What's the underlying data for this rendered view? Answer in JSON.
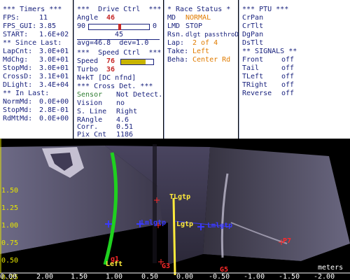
{
  "timers": {
    "header": "*** Timers ***",
    "fps_label": "FPS:",
    "fps_value": "11",
    "fpsgui_label": "FPS_GUI:",
    "fpsgui_value": "3.85",
    "start_label": "START:",
    "start_value": "1.6E+02",
    "since_header": "** Since Last:",
    "lapcnt_label": "LapCnt:",
    "lapcnt_value": "3.0E+01",
    "mdchg_label": "MdChg:",
    "mdchg_value": "3.0E+01",
    "stopmd_label": "StopMd:",
    "stopmd_value": "3.0E+01",
    "crossd_label": "CrossD:",
    "crossd_value": "3.1E+01",
    "dlight_label": "DLight:",
    "dlight_value": "3.4E+04",
    "inlast_header": "** In Last:",
    "normmd_label": "NormMd:",
    "normmd_value": "0.0E+00",
    "stopmd2_label": "StopMd:",
    "stopmd2_value": "2.8E-01",
    "rdmtmd_label": "RdMtMd:",
    "rdmtmd_value": "0.0E+00"
  },
  "drive": {
    "header": "***  Drive Ctrl  ***",
    "angle_label": "Angle",
    "angle_value": "46",
    "range_min": "90",
    "range_max": "0",
    "angle_slider_fraction": 0.51,
    "center_value": "45",
    "avg_text": "avg=46.8  dev=1.0",
    "speed_header": "***  Speed Ctrl  ***",
    "speed_label": "Speed",
    "speed_value": "76",
    "speed_fraction": 0.76,
    "turbo_label": "Turbo",
    "turbo_value": "36",
    "nokt_text": "N+kT [DC nfnd]"
  },
  "cross": {
    "header": "*** Cross Det. ***",
    "sensor_label": "Sensor",
    "sensor_value": "Not Detect.",
    "vision_label": "Vision",
    "vision_value": "no",
    "sline_label": "S. Line",
    "sline_value": "Right",
    "rangle_label": "RAngle",
    "rangle_value": "4.6",
    "corr_label": "Corr.",
    "corr_value": "0.51",
    "pix_label": "Pix Cnt",
    "pix_value": "1186"
  },
  "race": {
    "header": "* Race Status *",
    "md_label": "MD",
    "md_value": "NORMAL",
    "lmd_label": "LMD",
    "lmd_value": "STOP",
    "rsn_label": "Rsn.",
    "rsn_value": "dlgt passthroDgRan",
    "lap_label": "Lap:",
    "lap_value": "2 of 4",
    "take_label": "Take:",
    "take_value": "Left",
    "beha_label": "Beha:",
    "beha_value": "Center Rd"
  },
  "ptu": {
    "header": "*** PTU ***",
    "items": [
      "CrPan",
      "CrTlt",
      "DgPan",
      "DsTlt"
    ]
  },
  "signals": {
    "header": "** SIGNALS **",
    "rows": [
      {
        "name": "Front",
        "state": "off"
      },
      {
        "name": "Tail",
        "state": "off"
      },
      {
        "name": "TLeft",
        "state": "off"
      },
      {
        "name": "TRight",
        "state": "off"
      },
      {
        "name": "Reverse",
        "state": "off"
      }
    ]
  },
  "camera": {
    "y_ticks": [
      "1.50",
      "1.25",
      "1.00",
      "0.75",
      "0.50",
      "0.25",
      "0.00"
    ],
    "x_ticks": [
      "2.00",
      "1.50",
      "1.00",
      "0.50",
      "0.00",
      "-0.50",
      "-1.00",
      "-1.50",
      "-2.00"
    ],
    "units_label": "meters",
    "labels": {
      "left": "Left",
      "tlgtp": "TLgtp",
      "lgtp": "Lgtp",
      "lmlgtp": "Lmlgtp",
      "lmlgtp2": "Lmlgtp",
      "g1": "g1",
      "g3": "G3",
      "g5": "G5",
      "p7": "P7"
    },
    "colors": {
      "yellow": "#ffeb3b",
      "green": "#1fd11f",
      "blue": "#3a3aff",
      "red": "#ff2a2a"
    }
  }
}
